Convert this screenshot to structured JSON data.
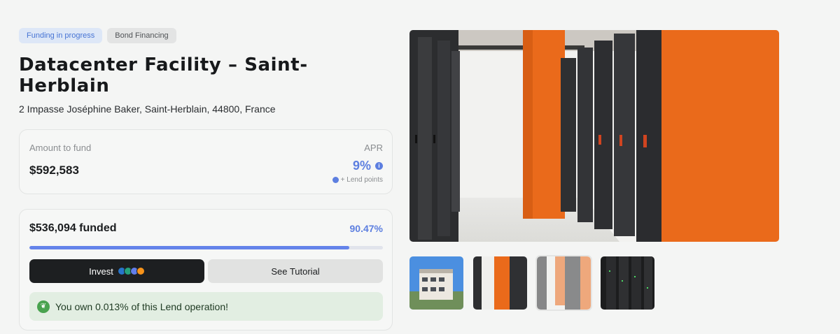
{
  "badges": {
    "status": "Funding in progress",
    "type": "Bond Financing"
  },
  "title": "Datacenter Facility – Saint-Herblain",
  "address": "2 Impasse Joséphine Baker, Saint-Herblain, 44800, France",
  "funding": {
    "amount_label": "Amount to fund",
    "amount_value": "$592,583",
    "apr_label": "APR",
    "apr_value": "9%",
    "lend_points": "+ Lend points"
  },
  "progress": {
    "funded_label": "$536,094 funded",
    "percent_label": "90.47%",
    "percent": 90.47
  },
  "actions": {
    "invest": "Invest",
    "tutorial": "See Tutorial"
  },
  "ownership": "You own 0.013% of this Lend operation!",
  "colors": {
    "accent": "#5d7fe0",
    "orange": "#ea6a1b",
    "success_bg": "#e2eee2"
  },
  "icons": {
    "info": "info-icon",
    "lend_points": "lend-points-icon",
    "coins": [
      "usdc-coin-icon",
      "usdt-coin-icon",
      "eth-coin-icon",
      "btc-coin-icon"
    ],
    "ownership": "leaf-icon"
  },
  "gallery": {
    "selected_index": 2,
    "thumbnails": [
      "building-exterior",
      "server-room-orange",
      "server-room-white",
      "server-racks-dark"
    ]
  }
}
